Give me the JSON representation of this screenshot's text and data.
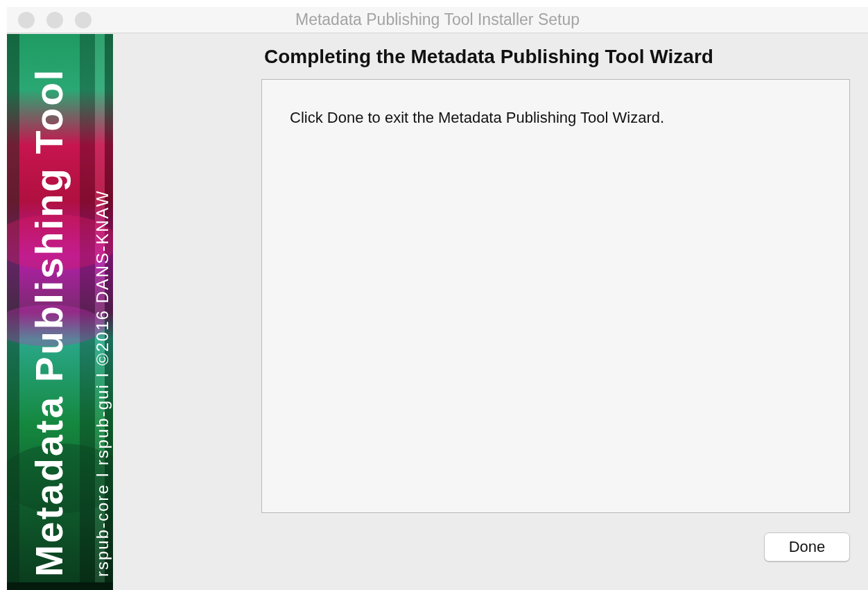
{
  "window": {
    "title": "Metadata Publishing Tool Installer Setup",
    "active": false
  },
  "banner": {
    "kind": "picture",
    "title": "Metadata Publishing Tool",
    "subtitle": "rspub-core I rspub-gui I ©2016 DANS-KNAW"
  },
  "page": {
    "heading": "Completing the Metadata Publishing Tool Wizard",
    "message": "Click Done to exit the Metadata Publishing Tool Wizard."
  },
  "buttons": [
    {
      "label": "Done"
    }
  ]
}
